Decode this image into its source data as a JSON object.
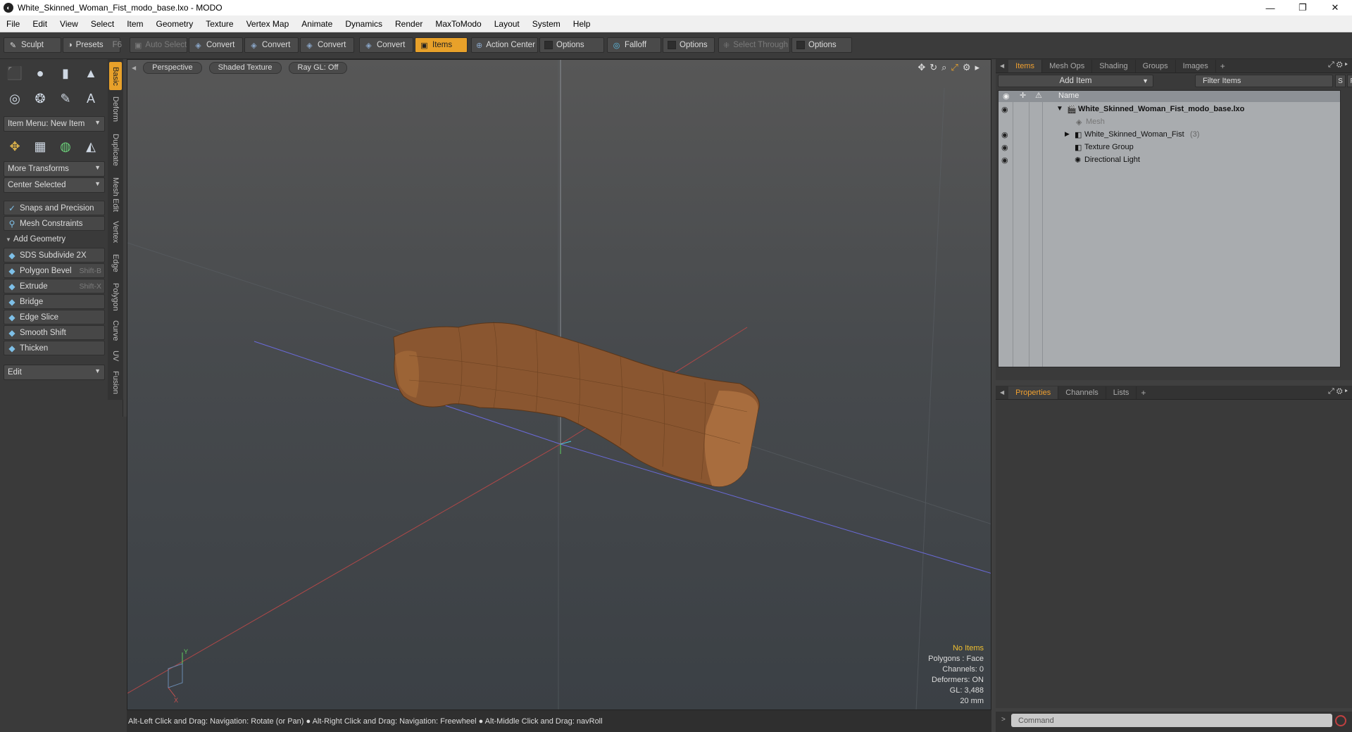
{
  "window": {
    "title": "White_Skinned_Woman_Fist_modo_base.lxo - MODO",
    "app_icon": "modo-logo-icon"
  },
  "menu": [
    "File",
    "Edit",
    "View",
    "Select",
    "Item",
    "Geometry",
    "Texture",
    "Vertex Map",
    "Animate",
    "Dynamics",
    "Render",
    "MaxToModo",
    "Layout",
    "System",
    "Help"
  ],
  "toolbar": {
    "sculpt": "Sculpt",
    "presets": "Presets",
    "presets_key": "F6",
    "auto_select": "Auto Select",
    "convert1": "Convert",
    "convert2": "Convert",
    "convert3": "Convert",
    "convert4": "Convert",
    "items": "Items",
    "action_center": "Action Center",
    "options1": "Options",
    "falloff": "Falloff",
    "options2": "Options",
    "select_through": "Select Through",
    "options3": "Options"
  },
  "left_panel": {
    "item_menu": "Item Menu: New Item",
    "more_transforms": "More Transforms",
    "center_selected": "Center Selected",
    "snaps": "Snaps and Precision",
    "mesh_constraints": "Mesh Constraints",
    "add_geometry": "Add Geometry",
    "tools": [
      {
        "label": "SDS Subdivide 2X",
        "shortcut": ""
      },
      {
        "label": "Polygon Bevel",
        "shortcut": "Shift-B"
      },
      {
        "label": "Extrude",
        "shortcut": "Shift-X"
      },
      {
        "label": "Bridge",
        "shortcut": ""
      },
      {
        "label": "Edge Slice",
        "shortcut": ""
      },
      {
        "label": "Smooth Shift",
        "shortcut": ""
      },
      {
        "label": "Thicken",
        "shortcut": ""
      }
    ],
    "edit": "Edit"
  },
  "vertical_tabs": [
    "Basic",
    "Deform",
    "Duplicate",
    "Mesh Edit",
    "Vertex",
    "Edge",
    "Polygon",
    "Curve",
    "UV",
    "Fusion"
  ],
  "viewport": {
    "perspective": "Perspective",
    "shaded": "Shaded Texture",
    "raygl": "Ray GL: Off",
    "stats": {
      "no_items": "No Items",
      "polygons": "Polygons : Face",
      "channels": "Channels: 0",
      "deformers": "Deformers: ON",
      "gl": "GL: 3,488",
      "scale": "20 mm"
    }
  },
  "status": "Alt-Left Click and Drag: Navigation: Rotate (or Pan) ● Alt-Right Click and Drag: Navigation: Freewheel ● Alt-Middle Click and Drag: navRoll",
  "items_panel": {
    "tabs": [
      "Items",
      "Mesh Ops",
      "Shading",
      "Groups",
      "Images"
    ],
    "add_item": "Add Item",
    "filter": "Filter Items",
    "s_btn": "S",
    "f_btn": "F",
    "name_col": "Name",
    "tree": [
      {
        "label": "White_Skinned_Woman_Fist_modo_base.lxo",
        "count": ""
      },
      {
        "label": "Mesh",
        "count": ""
      },
      {
        "label": "White_Skinned_Woman_Fist",
        "count": "(3)"
      },
      {
        "label": "Texture Group",
        "count": ""
      },
      {
        "label": "Directional Light",
        "count": ""
      }
    ]
  },
  "props_panel": {
    "tabs": [
      "Properties",
      "Channels",
      "Lists"
    ]
  },
  "command": {
    "placeholder": "Command"
  }
}
